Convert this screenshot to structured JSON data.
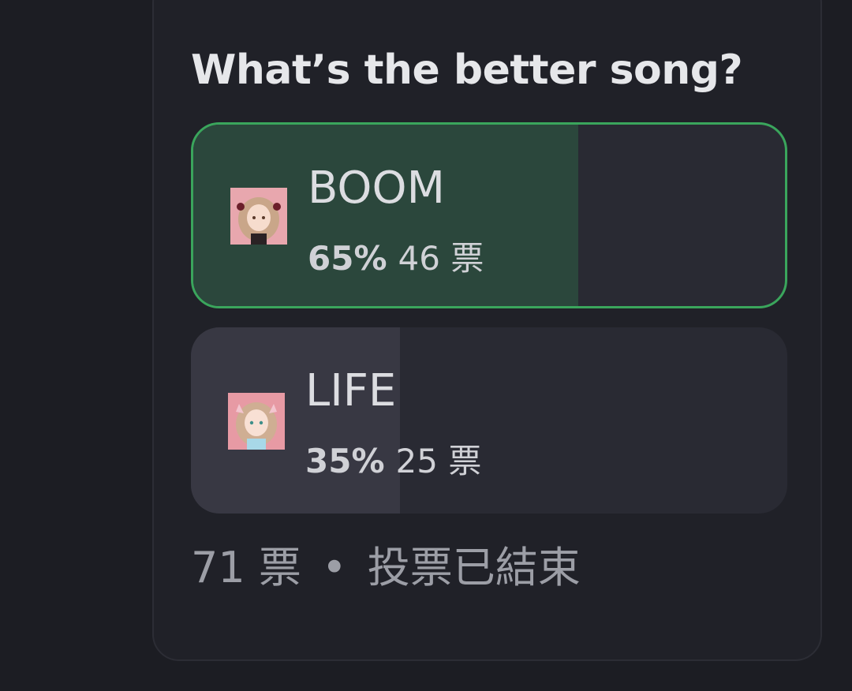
{
  "poll": {
    "question": "What’s the better song?",
    "options": [
      {
        "label": "BOOM",
        "percent": "65%",
        "votes": "46 票",
        "fraction": 0.65,
        "winner": true,
        "image_icon": "anime-girl-avatar-icon"
      },
      {
        "label": "LIFE",
        "percent": "35%",
        "votes": "25 票",
        "fraction": 0.35,
        "winner": false,
        "image_icon": "anime-girl-avatar-icon"
      }
    ],
    "footer": {
      "total_votes": "71 票",
      "separator": "•",
      "status": "投票已結束"
    }
  },
  "colors": {
    "background": "#1c1d23",
    "card": "#202128",
    "winner_border": "#3aa55c",
    "winner_fill": "#2b473c",
    "other_fill": "#383843",
    "option_track": "#292a33"
  }
}
